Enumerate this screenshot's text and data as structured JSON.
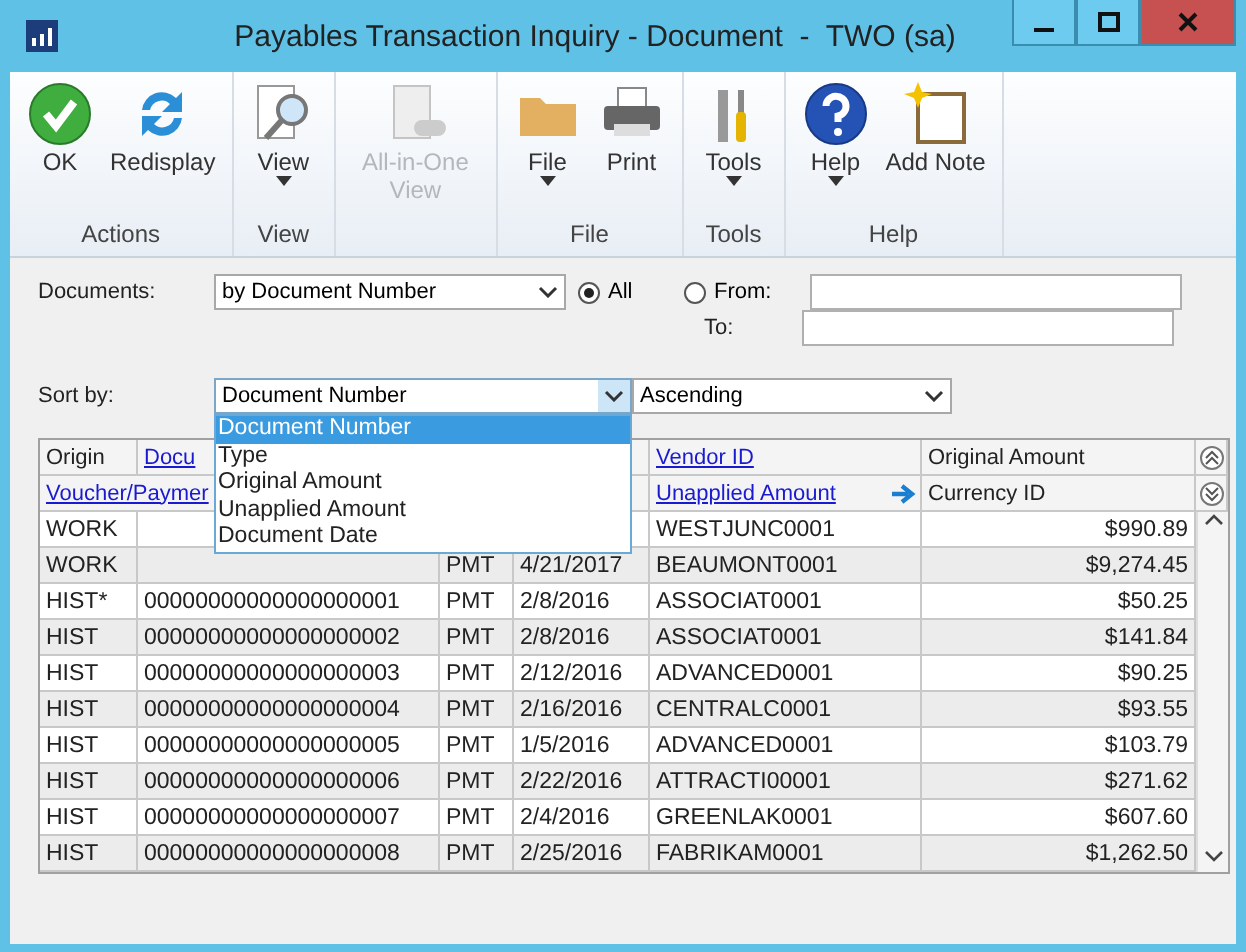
{
  "window": {
    "title": "Payables Transaction Inquiry - Document  -  TWO (sa)"
  },
  "ribbon": [
    {
      "label": "Actions",
      "buttons": [
        {
          "kind": "ok",
          "label": "OK",
          "disabled": false,
          "menu": false
        },
        {
          "kind": "refresh",
          "label": "Redisplay",
          "disabled": false,
          "menu": false
        }
      ]
    },
    {
      "label": "View",
      "buttons": [
        {
          "kind": "view",
          "label": "View",
          "disabled": false,
          "menu": true
        }
      ]
    },
    {
      "buttons": [
        {
          "kind": "allinone",
          "label": "All-in-One View",
          "disabled": true,
          "menu": false
        }
      ]
    },
    {
      "label": "File",
      "buttons": [
        {
          "kind": "folder",
          "label": "File",
          "disabled": false,
          "menu": true
        },
        {
          "kind": "printer",
          "label": "Print",
          "disabled": false,
          "menu": false
        }
      ]
    },
    {
      "label": "Tools",
      "buttons": [
        {
          "kind": "tools",
          "label": "Tools",
          "disabled": false,
          "menu": true
        }
      ]
    },
    {
      "label": "Help",
      "buttons": [
        {
          "kind": "help",
          "label": "Help",
          "disabled": false,
          "menu": true
        },
        {
          "kind": "note",
          "label": "Add Note",
          "disabled": false,
          "menu": false
        }
      ]
    }
  ],
  "documents": {
    "label": "Documents:",
    "value": "by Document Number",
    "range": [
      {
        "label": "All",
        "selected": true
      },
      {
        "label": "From:",
        "selected": false
      }
    ],
    "to_label": "To:"
  },
  "sort": {
    "label": "Sort by:",
    "value": "Document Number",
    "order": "Ascending",
    "open": true,
    "options": [
      {
        "label": "Document Number",
        "selected": true
      },
      {
        "label": "Type",
        "selected": false
      },
      {
        "label": "Original Amount",
        "selected": false
      },
      {
        "label": "Unapplied Amount",
        "selected": false
      },
      {
        "label": "Document Date",
        "selected": false
      }
    ]
  },
  "table": {
    "header_1": [
      {
        "text": "Origin",
        "link": false
      },
      {
        "text": "Docu",
        "link": true
      },
      {
        "text": "Vendor ID",
        "link": true
      },
      {
        "text": "Original Amount",
        "link": false
      }
    ],
    "header_2": [
      {
        "text": "Voucher/Paymer",
        "link": true
      },
      {
        "text": "Unapplied Amount",
        "link": true
      },
      {
        "text": "Currency ID",
        "link": false
      }
    ],
    "rows": [
      [
        "WORK",
        null,
        null,
        null,
        "WESTJUNC0001",
        "$990.89"
      ],
      [
        "WORK",
        null,
        "PMT",
        "4/21/2017",
        "BEAUMONT0001",
        "$9,274.45"
      ],
      [
        "HIST*",
        "00000000000000000001",
        "PMT",
        "2/8/2016",
        "ASSOCIAT0001",
        "$50.25"
      ],
      [
        "HIST",
        "00000000000000000002",
        "PMT",
        "2/8/2016",
        "ASSOCIAT0001",
        "$141.84"
      ],
      [
        "HIST",
        "00000000000000000003",
        "PMT",
        "2/12/2016",
        "ADVANCED0001",
        "$90.25"
      ],
      [
        "HIST",
        "00000000000000000004",
        "PMT",
        "2/16/2016",
        "CENTRALC0001",
        "$93.55"
      ],
      [
        "HIST",
        "00000000000000000005",
        "PMT",
        "1/5/2016",
        "ADVANCED0001",
        "$103.79"
      ],
      [
        "HIST",
        "00000000000000000006",
        "PMT",
        "2/22/2016",
        "ATTRACTI00001",
        "$271.62"
      ],
      [
        "HIST",
        "00000000000000000007",
        "PMT",
        "2/4/2016",
        "GREENLAK0001",
        "$607.60"
      ],
      [
        "HIST",
        "00000000000000000008",
        "PMT",
        "2/25/2016",
        "FABRIKAM0001",
        "$1,262.50"
      ]
    ]
  }
}
